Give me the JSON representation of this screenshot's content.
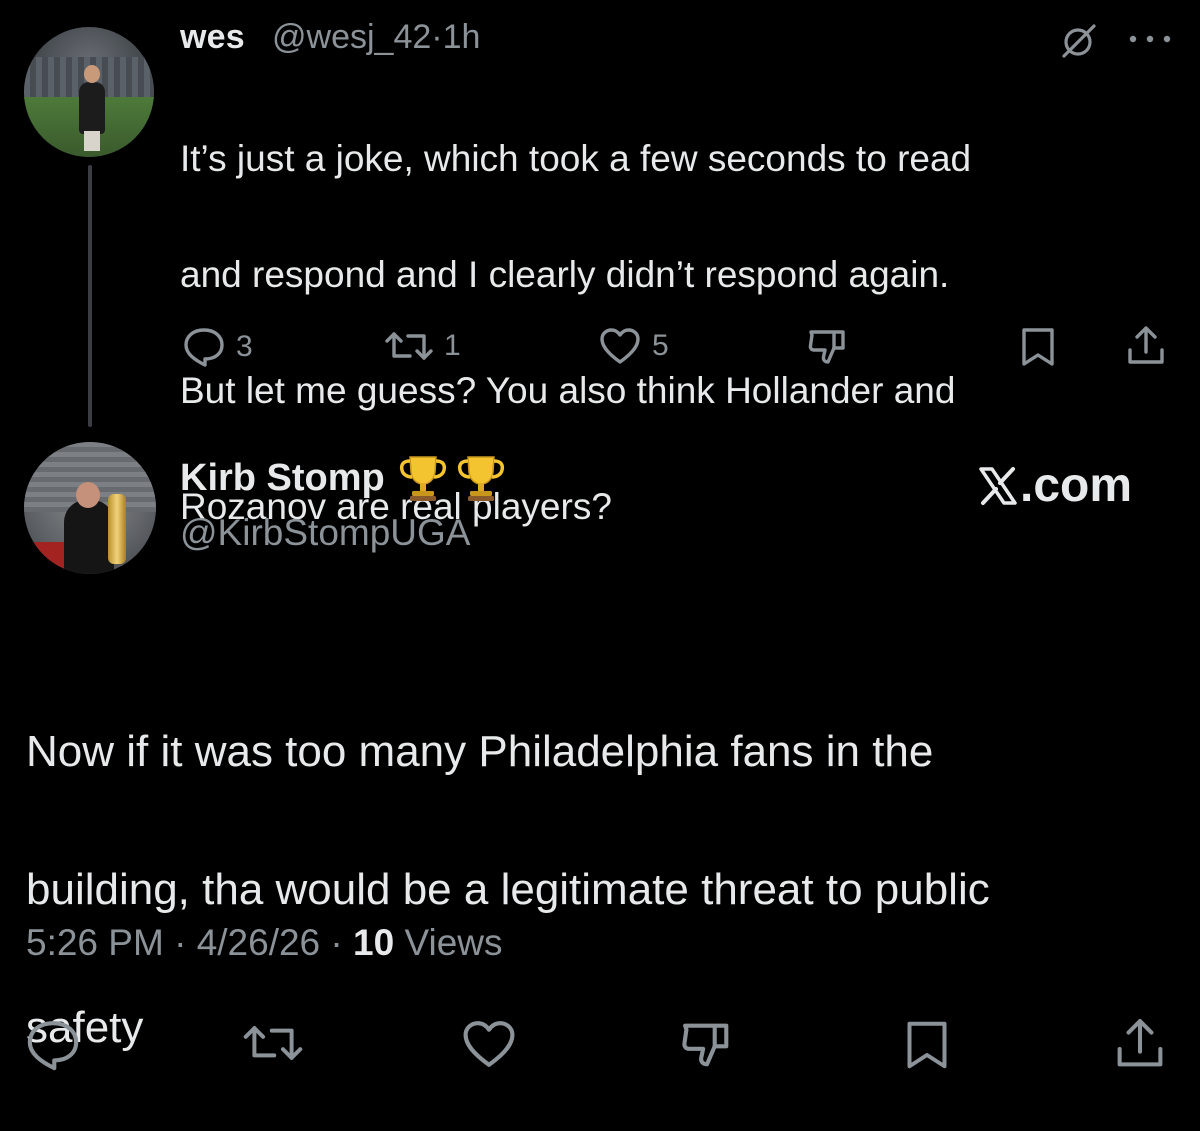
{
  "reply_tweet": {
    "display_name": "wes",
    "handle": "@wesj_42",
    "separator": "·",
    "time_ago": "1h",
    "text_lines": [
      "It’s just a joke, which took a few seconds to read",
      "and respond and I clearly didn’t respond again.",
      "But let me guess? You also think Hollander and",
      "Rozanov are real players?"
    ],
    "counts": {
      "replies": "3",
      "reposts": "1",
      "likes": "5"
    },
    "icons": {
      "grok": "grok-icon",
      "more": "more-options-icon"
    }
  },
  "main_tweet": {
    "display_name": "Kirb Stomp",
    "name_emoji": [
      "🏆",
      "🏆"
    ],
    "handle": "@KirbStompUGA",
    "watermark": ".com",
    "text_lines": [
      "Now if it was too many Philadelphia fans in the",
      "building, tha would be a legitimate threat to public",
      "safety"
    ],
    "time": "5:26 PM",
    "separator": "·",
    "date": "4/26/26",
    "views_count": "10",
    "views_label": "Views"
  },
  "actions": {
    "icons": [
      "reply-icon",
      "repost-icon",
      "like-icon",
      "dislike-icon",
      "bookmark-icon",
      "share-icon"
    ]
  },
  "colors": {
    "background": "#000000",
    "primary_text": "#e7e9ea",
    "secondary_text": "#8b9298",
    "thread_line": "#3a3d41"
  }
}
